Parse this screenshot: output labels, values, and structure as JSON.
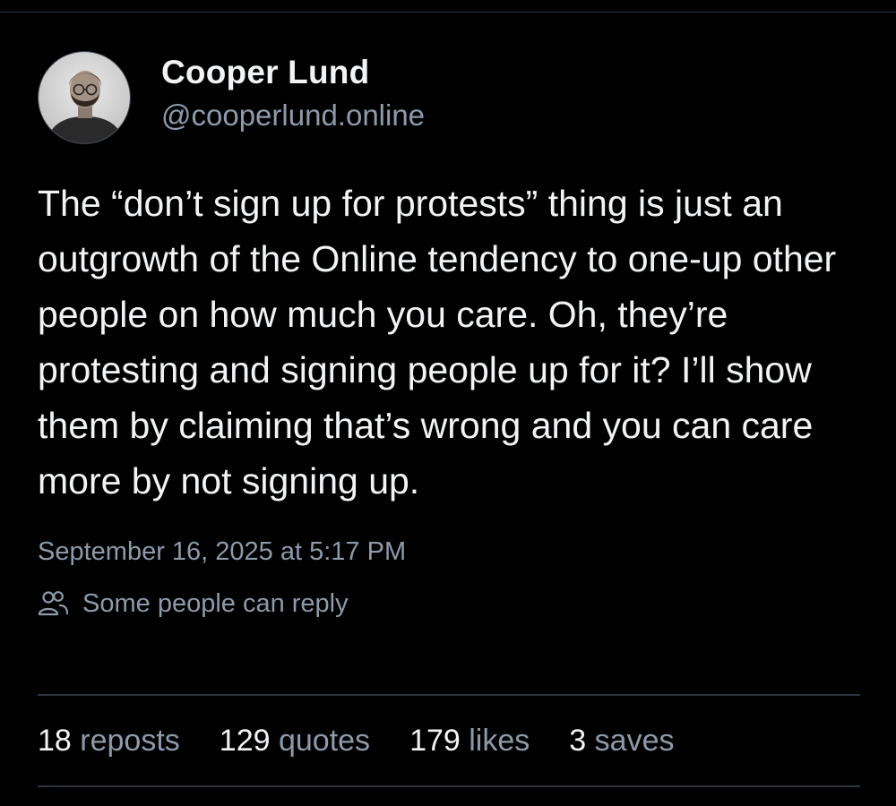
{
  "author": {
    "display_name": "Cooper Lund",
    "handle": "@cooperlund.online",
    "avatar_icon": "user-avatar-photo"
  },
  "post": {
    "text": "The “don’t sign up for protests” thing is just an outgrowth of the Online tendency to one-up other people on how much you care. Oh, they’re protesting and signing people up for it? I’ll show them by claiming that’s wrong and you can care more by not signing up.",
    "timestamp": "September 16, 2025 at 5:17 PM",
    "reply_setting": {
      "icon": "people-icon",
      "label": "Some people can reply"
    }
  },
  "stats": [
    {
      "count": "18",
      "label": "reposts"
    },
    {
      "count": "129",
      "label": "quotes"
    },
    {
      "count": "179",
      "label": "likes"
    },
    {
      "count": "3",
      "label": "saves"
    }
  ],
  "colors": {
    "background": "#000000",
    "primary_text": "#f1f3f5",
    "secondary_text": "#8d9aab",
    "divider": "#2b3440"
  }
}
